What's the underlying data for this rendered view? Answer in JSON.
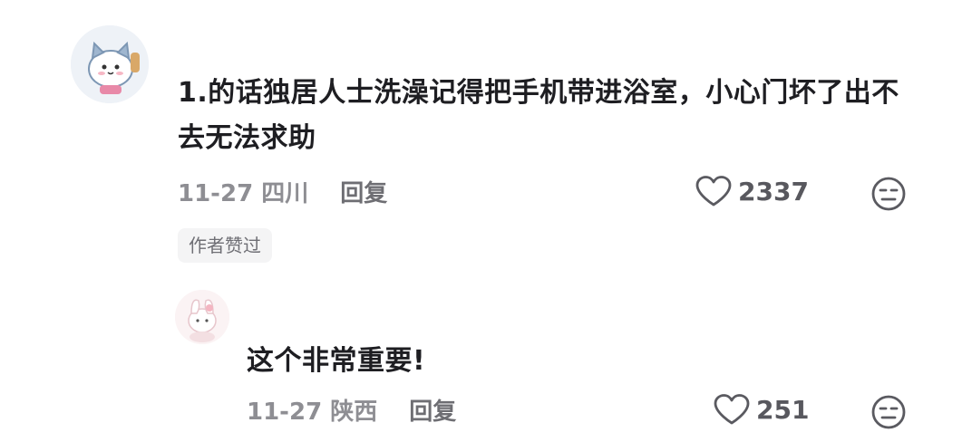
{
  "comments": [
    {
      "text": "1.的话独居人士洗澡记得把手机带进浴室，小心门坏了出不去无法求助",
      "date": "11-27",
      "location": "四川",
      "reply_label": "回复",
      "likes": "2337",
      "badge": "作者赞过"
    },
    {
      "text": "这个非常重要!",
      "date": "11-27",
      "location": "陕西",
      "reply_label": "回复",
      "likes": "251"
    }
  ],
  "icons": {
    "like": "heart-icon",
    "dislike": "unamused-face-icon"
  },
  "colors": {
    "text_primary": "#1e1e22",
    "text_meta": "#8e8e93",
    "badge_bg": "#f4f4f5"
  }
}
